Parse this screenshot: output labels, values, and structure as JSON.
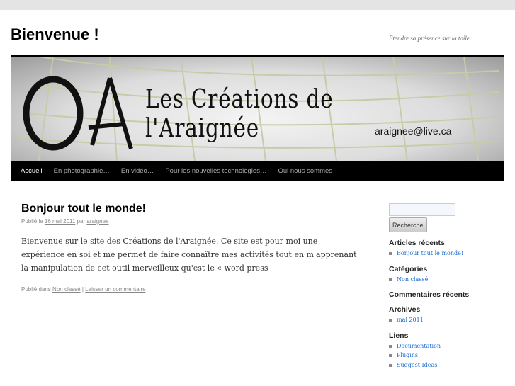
{
  "site": {
    "title": "Bienvenue !",
    "tagline": "Étendre sa présence sur la toile"
  },
  "banner": {
    "title": "Les Créations de l'Araignée",
    "email": "araignee@live.ca",
    "logo_text": "OA"
  },
  "nav": [
    "Accueil",
    "En photographie…",
    "En vidéo…",
    "Pour les nouvelles technologies…",
    "Qui nous sommes"
  ],
  "post": {
    "title": "Bonjour tout le monde!",
    "published_prefix": "Publié le",
    "date": "16 mai 2011",
    "by": "par",
    "author": "araignee",
    "body": "Bienvenue sur le site des Créations de l'Araignée. Ce site est pour moi une expérience en soi et me permet de faire connaître mes activités tout en m'apprenant la manipulation de cet outil merveilleux qu'est le « word press",
    "filed_prefix": "Publié dans",
    "category": "Non classé",
    "sep": "|",
    "comment_link": "Laisser un commentaire"
  },
  "sidebar": {
    "search_value": "",
    "search_button": "Recherche",
    "widgets": [
      {
        "title": "Articles récents",
        "items": [
          "Bonjour tout le monde!"
        ]
      },
      {
        "title": "Catégories",
        "items": [
          "Non classé"
        ]
      },
      {
        "title": "Commentaires récents",
        "items": []
      },
      {
        "title": "Archives",
        "items": [
          "mai 2011"
        ]
      },
      {
        "title": "Liens",
        "items": [
          "Documentation",
          "Plugins",
          "Suggest Ideas"
        ]
      }
    ]
  }
}
